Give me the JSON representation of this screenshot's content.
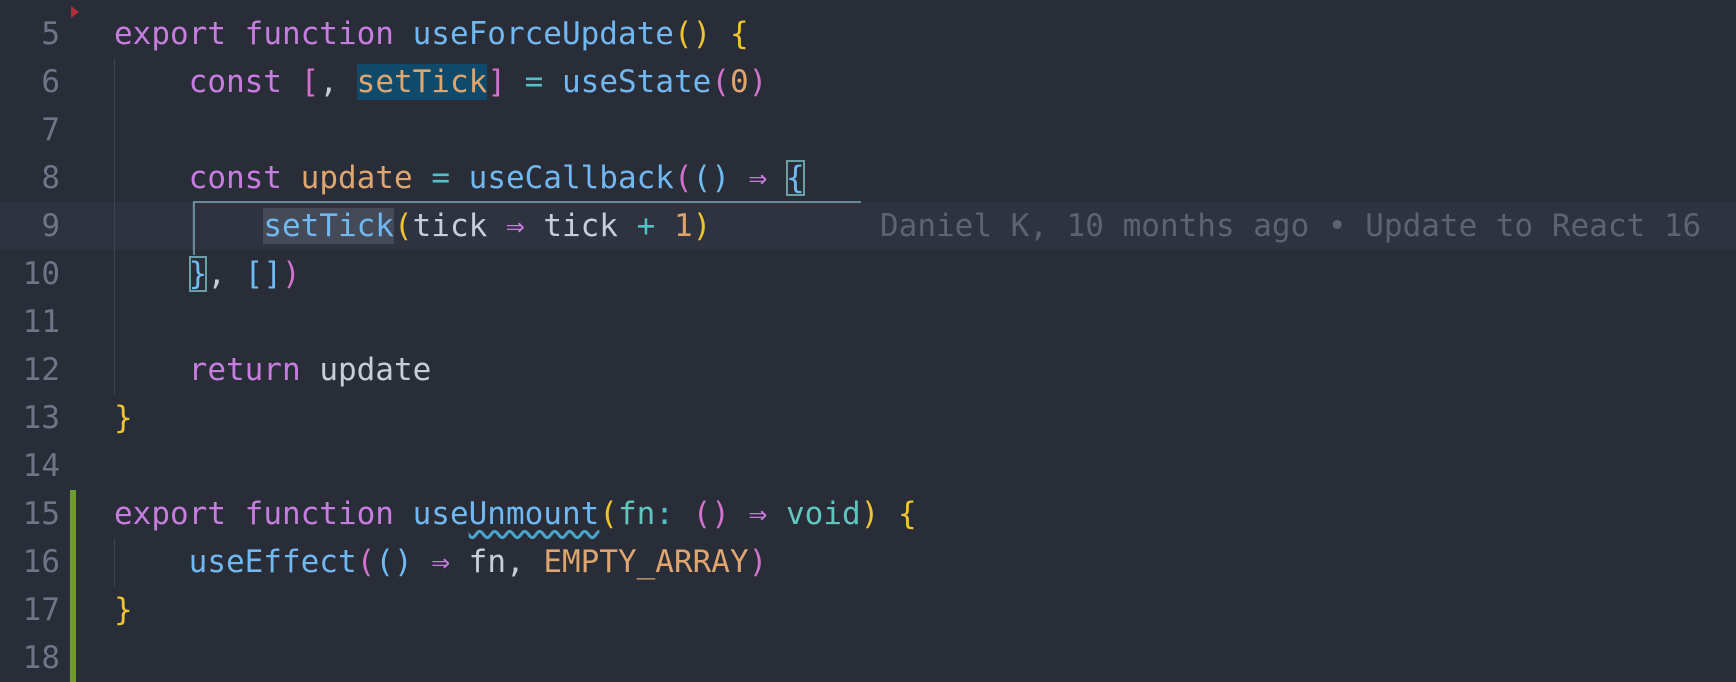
{
  "editor": {
    "lines": [
      {
        "n": "5",
        "tokens": [
          [
            "export",
            "kw"
          ],
          [
            " ",
            "plain"
          ],
          [
            "function",
            "kw"
          ],
          [
            " ",
            "plain"
          ],
          [
            "useForceUpdate",
            "fn"
          ],
          [
            "(",
            "b1"
          ],
          [
            ")",
            "b1"
          ],
          [
            " ",
            "plain"
          ],
          [
            "{",
            "b1"
          ]
        ]
      },
      {
        "n": "6",
        "tokens": [
          [
            "    ",
            "plain"
          ],
          [
            "const",
            "kw"
          ],
          [
            " ",
            "plain"
          ],
          [
            "[",
            "b2"
          ],
          [
            ", ",
            "plain"
          ],
          [
            "setTick",
            "var sel"
          ],
          [
            "]",
            "b2"
          ],
          [
            " ",
            "plain"
          ],
          [
            "=",
            "op"
          ],
          [
            " ",
            "plain"
          ],
          [
            "useState",
            "fn"
          ],
          [
            "(",
            "b2"
          ],
          [
            "0",
            "num"
          ],
          [
            ")",
            "b2"
          ]
        ]
      },
      {
        "n": "7",
        "tokens": []
      },
      {
        "n": "8",
        "tokens": [
          [
            "    ",
            "plain"
          ],
          [
            "const",
            "kw"
          ],
          [
            " ",
            "plain"
          ],
          [
            "update",
            "var"
          ],
          [
            " ",
            "plain"
          ],
          [
            "=",
            "op"
          ],
          [
            " ",
            "plain"
          ],
          [
            "useCallback",
            "fn"
          ],
          [
            "(",
            "b2"
          ],
          [
            "(",
            "b3"
          ],
          [
            ")",
            "b3"
          ],
          [
            " ",
            "plain"
          ],
          [
            "⇒",
            "kw"
          ],
          [
            " ",
            "plain"
          ],
          [
            "{",
            "b3 box"
          ]
        ]
      },
      {
        "n": "9",
        "tokens": [
          [
            "        ",
            "plain"
          ],
          [
            "setTick",
            "fn word"
          ],
          [
            "(",
            "b1"
          ],
          [
            "tick",
            "plain"
          ],
          [
            " ",
            "plain"
          ],
          [
            "⇒",
            "kw"
          ],
          [
            " ",
            "plain"
          ],
          [
            "tick",
            "plain"
          ],
          [
            " ",
            "plain"
          ],
          [
            "+",
            "op"
          ],
          [
            " ",
            "plain"
          ],
          [
            "1",
            "num"
          ],
          [
            ")",
            "b1"
          ]
        ],
        "blame": "Daniel K, 10 months ago • Update to React 16"
      },
      {
        "n": "10",
        "tokens": [
          [
            "    ",
            "plain"
          ],
          [
            "}",
            "b3 box"
          ],
          [
            ", ",
            "plain"
          ],
          [
            "[",
            "b3"
          ],
          [
            "]",
            "b3"
          ],
          [
            ")",
            "b2"
          ]
        ]
      },
      {
        "n": "11",
        "tokens": []
      },
      {
        "n": "12",
        "tokens": [
          [
            "    ",
            "plain"
          ],
          [
            "return",
            "kw"
          ],
          [
            " ",
            "plain"
          ],
          [
            "update",
            "plain"
          ]
        ]
      },
      {
        "n": "13",
        "tokens": [
          [
            "}",
            "b1"
          ]
        ]
      },
      {
        "n": "14",
        "tokens": []
      },
      {
        "n": "15",
        "tokens": [
          [
            "export",
            "kw"
          ],
          [
            " ",
            "plain"
          ],
          [
            "function",
            "kw"
          ],
          [
            " ",
            "plain"
          ],
          [
            "use",
            "fn"
          ],
          [
            "Unmount",
            "fn squig"
          ],
          [
            "(",
            "b1"
          ],
          [
            "fn",
            "type"
          ],
          [
            ": ",
            "op"
          ],
          [
            "(",
            "b2"
          ],
          [
            ")",
            "b2"
          ],
          [
            " ",
            "plain"
          ],
          [
            "⇒",
            "kw"
          ],
          [
            " ",
            "plain"
          ],
          [
            "void",
            "type"
          ],
          [
            ")",
            "b1"
          ],
          [
            " ",
            "plain"
          ],
          [
            "{",
            "b1"
          ]
        ]
      },
      {
        "n": "16",
        "tokens": [
          [
            "    ",
            "plain"
          ],
          [
            "useEffect",
            "fn"
          ],
          [
            "(",
            "b2"
          ],
          [
            "(",
            "b3"
          ],
          [
            ")",
            "b3"
          ],
          [
            " ",
            "plain"
          ],
          [
            "⇒",
            "kw"
          ],
          [
            " ",
            "plain"
          ],
          [
            "fn",
            "plain"
          ],
          [
            ", ",
            "plain"
          ],
          [
            "EMPTY_ARRAY",
            "var"
          ],
          [
            ")",
            "b2"
          ]
        ]
      },
      {
        "n": "17",
        "tokens": [
          [
            "}",
            "b1"
          ]
        ]
      },
      {
        "n": "18",
        "tokens": []
      }
    ]
  }
}
